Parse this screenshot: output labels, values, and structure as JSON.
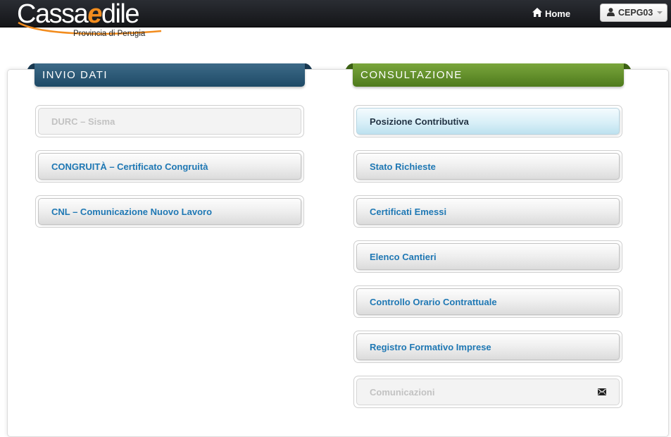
{
  "header": {
    "logo": {
      "brand_part1": "Cassa",
      "brand_part2": "e",
      "brand_part3": "dile",
      "subtitle": "Provincia di Perugia"
    },
    "home_label": "Home",
    "home_icon": "home-icon",
    "user_label": "CEPG03",
    "user_icon": "user-icon"
  },
  "invio": {
    "title": "INVIO DATI",
    "color": "#2a5674",
    "items": [
      {
        "label": "DURC – Sisma",
        "state": "disabled"
      },
      {
        "label": "CONGRUITÀ – Certificato Congruità",
        "state": "normal"
      },
      {
        "label": "CNL – Comunicazione Nuovo Lavoro",
        "state": "normal"
      }
    ]
  },
  "consultazione": {
    "title": "CONSULTAZIONE",
    "color": "#5f8a26",
    "items": [
      {
        "label": "Posizione Contributiva",
        "state": "active"
      },
      {
        "label": "Stato Richieste",
        "state": "normal"
      },
      {
        "label": "Certificati Emessi",
        "state": "normal"
      },
      {
        "label": "Elenco Cantieri",
        "state": "normal"
      },
      {
        "label": "Controllo Orario Contrattuale",
        "state": "normal"
      },
      {
        "label": "Registro Formativo Imprese",
        "state": "normal"
      },
      {
        "label": "Comunicazioni",
        "state": "disabled",
        "icon": "envelope-icon"
      }
    ]
  },
  "colors": {
    "link": "#1f78b4",
    "accent_orange": "#f28c1e"
  }
}
